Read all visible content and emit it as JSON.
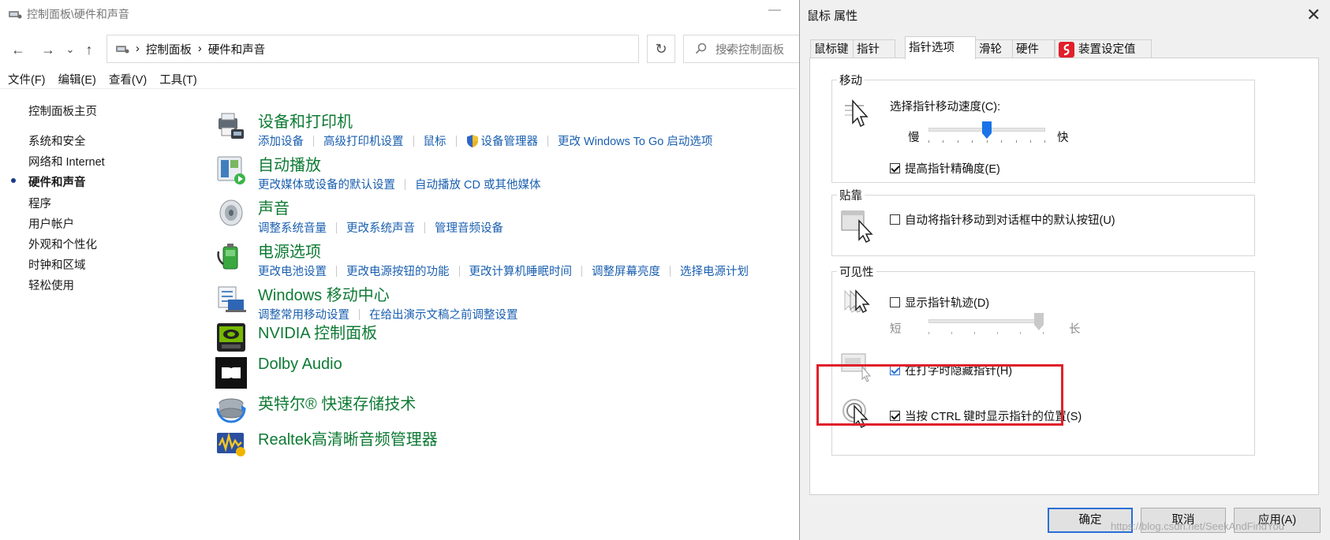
{
  "control_panel": {
    "window_title": "控制面板\\硬件和声音",
    "nav": {
      "back": "←",
      "forward": "→",
      "recent": "⌄",
      "up": "↑"
    },
    "breadcrumbs": [
      "控制面板",
      "硬件和声音"
    ],
    "refresh": "↻",
    "search_placeholder": "搜索控制面板",
    "menu": [
      "文件(F)",
      "编辑(E)",
      "查看(V)",
      "工具(T)"
    ],
    "sidebar": [
      {
        "label": "控制面板主页",
        "active": false
      },
      {
        "label": "系统和安全",
        "active": false
      },
      {
        "label": "网络和 Internet",
        "active": false
      },
      {
        "label": "硬件和声音",
        "active": true
      },
      {
        "label": "程序",
        "active": false
      },
      {
        "label": "用户帐户",
        "active": false
      },
      {
        "label": "外观和个性化",
        "active": false
      },
      {
        "label": "时钟和区域",
        "active": false
      },
      {
        "label": "轻松使用",
        "active": false
      }
    ],
    "categories": [
      {
        "title": "设备和打印机",
        "icon": "printer-icon",
        "links": [
          "添加设备",
          "高级打印机设置",
          "鼠标",
          "设备管理器",
          "更改 Windows To Go 启动选项"
        ]
      },
      {
        "title": "自动播放",
        "icon": "autoplay-icon",
        "links": [
          "更改媒体或设备的默认设置",
          "自动播放 CD 或其他媒体"
        ]
      },
      {
        "title": "声音",
        "icon": "speaker-icon",
        "links": [
          "调整系统音量",
          "更改系统声音",
          "管理音频设备"
        ]
      },
      {
        "title": "电源选项",
        "icon": "battery-icon",
        "links": [
          "更改电池设置",
          "更改电源按钮的功能",
          "更改计算机睡眠时间",
          "调整屏幕亮度",
          "选择电源计划"
        ]
      },
      {
        "title": "Windows 移动中心",
        "icon": "mobility-center-icon",
        "links": [
          "调整常用移动设置",
          "在给出演示文稿之前调整设置"
        ]
      },
      {
        "title": "NVIDIA 控制面板",
        "icon": "nvidia-icon",
        "links": []
      },
      {
        "title": "Dolby Audio",
        "icon": "dolby-icon",
        "links": []
      },
      {
        "title": "英特尔® 快速存储技术",
        "icon": "intel-rst-icon",
        "links": []
      },
      {
        "title": "Realtek高清晰音频管理器",
        "icon": "realtek-icon",
        "links": []
      }
    ]
  },
  "dialog": {
    "title": "鼠标 属性",
    "close": "✕",
    "tabs": [
      "鼠标键",
      "指针",
      "指针选项",
      "滑轮",
      "硬件",
      "装置设定值"
    ],
    "active_tab": 2,
    "motion": {
      "legend": "移动",
      "speed_label": "选择指针移动速度(C):",
      "slow": "慢",
      "fast": "快",
      "speed_value": 0.5,
      "precision_label": "提高指针精确度(E)",
      "precision_checked": true
    },
    "snap": {
      "legend": "贴靠",
      "label": "自动将指针移动到对话框中的默认按钮(U)",
      "checked": false
    },
    "visibility": {
      "legend": "可见性",
      "trails_label": "显示指针轨迹(D)",
      "trails_checked": false,
      "short": "短",
      "long": "长",
      "trail_value": 1.0,
      "hide_label": "在打字时隐藏指针(H)",
      "hide_checked": true,
      "ctrl_label": "当按 CTRL 键时显示指针的位置(S)",
      "ctrl_checked": true
    },
    "buttons": {
      "ok": "确定",
      "cancel": "取消",
      "apply": "应用(A)"
    },
    "watermark": "https://blog.csdn.net/SeekAndFindYou",
    "highlight_color": "#e0202a"
  },
  "colors": {
    "link": "#1a5fb0",
    "category_title": "#0e7a34",
    "dialog_bg": "#f0f0f0",
    "slider_thumb": "#1a73e8"
  }
}
